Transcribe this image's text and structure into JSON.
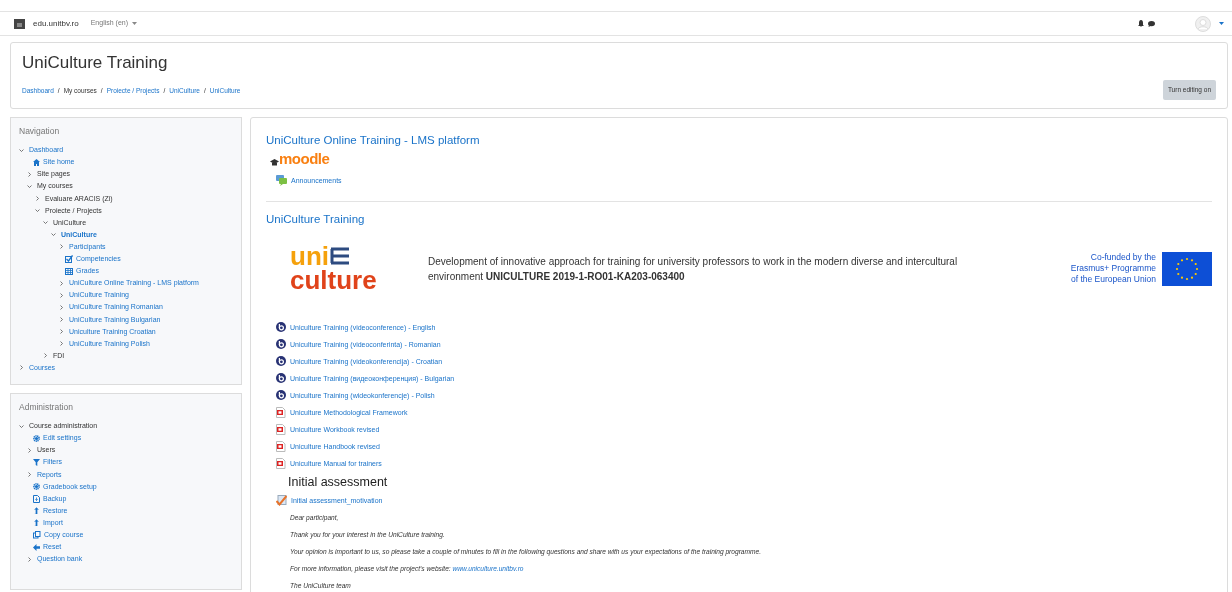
{
  "navbar": {
    "site_name": "edu.unitbv.ro",
    "language": "English (en)"
  },
  "header": {
    "title": "UniCulture Training",
    "breadcrumb": [
      {
        "label": "Dashboard",
        "link": true
      },
      {
        "label": "My courses",
        "link": false
      },
      {
        "label": "Proiecte / Projects",
        "link": true
      },
      {
        "label": "UniCulture",
        "link": true
      },
      {
        "label": "UniCulture",
        "link": true
      }
    ],
    "breadcrumb_separator": "/",
    "edit_button": "Turn editing on"
  },
  "navigation": {
    "title": "Navigation",
    "items": [
      {
        "label": "Dashboard",
        "kind": "branch",
        "expanded": true,
        "link": true,
        "selected": false,
        "children": [
          {
            "label": "Site home",
            "kind": "home",
            "link": true,
            "selected": false
          },
          {
            "label": "Site pages",
            "kind": "branch",
            "expanded": false,
            "link": false,
            "selected": false
          },
          {
            "label": "My courses",
            "kind": "branch",
            "expanded": true,
            "link": false,
            "selected": false,
            "children": [
              {
                "label": "Evaluare ARACIS (Zi)",
                "kind": "branch",
                "expanded": false,
                "link": false,
                "selected": false
              },
              {
                "label": "Proiecte / Projects",
                "kind": "branch",
                "expanded": true,
                "link": false,
                "selected": false,
                "children": [
                  {
                    "label": "UniCulture",
                    "kind": "branch",
                    "expanded": true,
                    "link": false,
                    "selected": false,
                    "children": [
                      {
                        "label": "UniCulture",
                        "kind": "branch",
                        "expanded": true,
                        "link": true,
                        "selected": true,
                        "children": [
                          {
                            "label": "Participants",
                            "kind": "branch",
                            "expanded": false,
                            "link": true,
                            "selected": false
                          },
                          {
                            "label": "Competencies",
                            "kind": "check",
                            "link": true,
                            "selected": false
                          },
                          {
                            "label": "Grades",
                            "kind": "grid",
                            "link": true,
                            "selected": false
                          },
                          {
                            "label": "UniCulture Online Training - LMS platform",
                            "kind": "branch",
                            "expanded": false,
                            "link": true,
                            "selected": false
                          },
                          {
                            "label": "UniCulture Training",
                            "kind": "branch",
                            "expanded": false,
                            "link": true,
                            "selected": false
                          },
                          {
                            "label": "UniCulture Training Romanian",
                            "kind": "branch",
                            "expanded": false,
                            "link": true,
                            "selected": false
                          },
                          {
                            "label": "UniCulture Training Bulgarian",
                            "kind": "branch",
                            "expanded": false,
                            "link": true,
                            "selected": false
                          },
                          {
                            "label": "Uniculture Training Croatian",
                            "kind": "branch",
                            "expanded": false,
                            "link": true,
                            "selected": false
                          },
                          {
                            "label": "UniCulture Training Polish",
                            "kind": "branch",
                            "expanded": false,
                            "link": true,
                            "selected": false
                          }
                        ]
                      }
                    ]
                  },
                  {
                    "label": "FDI",
                    "kind": "branch",
                    "expanded": false,
                    "link": false,
                    "selected": false
                  }
                ]
              }
            ]
          }
        ]
      },
      {
        "label": "Courses",
        "kind": "branch",
        "expanded": false,
        "link": true,
        "selected": false
      }
    ]
  },
  "administration": {
    "title": "Administration",
    "items": [
      {
        "label": "Course administration",
        "kind": "branch",
        "expanded": true,
        "link": false,
        "selected": false,
        "children": [
          {
            "label": "Edit settings",
            "kind": "gear",
            "link": true,
            "selected": false
          },
          {
            "label": "Users",
            "kind": "branch",
            "expanded": false,
            "link": false,
            "selected": false
          },
          {
            "label": "Filters",
            "kind": "filter",
            "link": true,
            "selected": false
          },
          {
            "label": "Reports",
            "kind": "branch",
            "expanded": false,
            "link": true,
            "selected": false
          },
          {
            "label": "Gradebook setup",
            "kind": "gear",
            "link": true,
            "selected": false
          },
          {
            "label": "Backup",
            "kind": "backup",
            "link": true,
            "selected": false
          },
          {
            "label": "Restore",
            "kind": "upload",
            "link": true,
            "selected": false
          },
          {
            "label": "Import",
            "kind": "upload",
            "link": true,
            "selected": false
          },
          {
            "label": "Copy course",
            "kind": "copy",
            "link": true,
            "selected": false
          },
          {
            "label": "Reset",
            "kind": "reset",
            "link": true,
            "selected": false
          },
          {
            "label": "Question bank",
            "kind": "branch",
            "expanded": false,
            "link": true,
            "selected": false
          }
        ]
      }
    ]
  },
  "sections": [
    {
      "title": "UniCulture Online Training - LMS platform",
      "logo_text": "moodle",
      "activities": [
        {
          "label": "Announcements",
          "kind": "forum"
        }
      ]
    },
    {
      "title": "UniCulture Training",
      "banner": {
        "logo_top": "uni",
        "logo_bottom": "culture",
        "description": "Development of innovative approach for training for university professors to work in  the modern diverse and intercultural environment **UNICULTURE 2019-1-RO01-KA203-063400**",
        "funding": [
          "Co-funded by the",
          "Erasmus+ Programme",
          "of the European Union"
        ]
      },
      "activities": [
        {
          "label": "Uniculture Training (videoconference) - English",
          "kind": "conference"
        },
        {
          "label": "Uniculture Training (videoconferinta) - Romanian",
          "kind": "conference"
        },
        {
          "label": "Uniculture Training (videokonferencija) - Croatian",
          "kind": "conference"
        },
        {
          "label": "Uniculture Training (видеоконференция) - Bulgarian",
          "kind": "conference"
        },
        {
          "label": "Uniculture Training (wideokonferencje) - Polish",
          "kind": "conference"
        },
        {
          "label": "Uniculture Methodological Framework",
          "kind": "pdf"
        },
        {
          "label": "Uniculture Workbook revised",
          "kind": "pdf"
        },
        {
          "label": "Uniculture Handbook revised",
          "kind": "pdf"
        },
        {
          "label": "Uniculture Manual for trainers",
          "kind": "pdf"
        },
        {
          "label": "Initial assessment",
          "kind": "heading"
        },
        {
          "label": "Initial assessment_motivation",
          "kind": "quiz"
        }
      ],
      "notes": [
        {
          "text": "Dear participant,"
        },
        {
          "text": "Thank you for your interest in the UniCulture training."
        },
        {
          "text": "Your opinion is important to us, so please take a couple of minutes to fill in the following questions and share with us your expectations of the training programme."
        },
        {
          "text": "For more information, please visit the project's website: ",
          "link": "www.uniculture.unitbv.ro"
        },
        {
          "text": "The UniCulture team"
        }
      ]
    }
  ]
}
